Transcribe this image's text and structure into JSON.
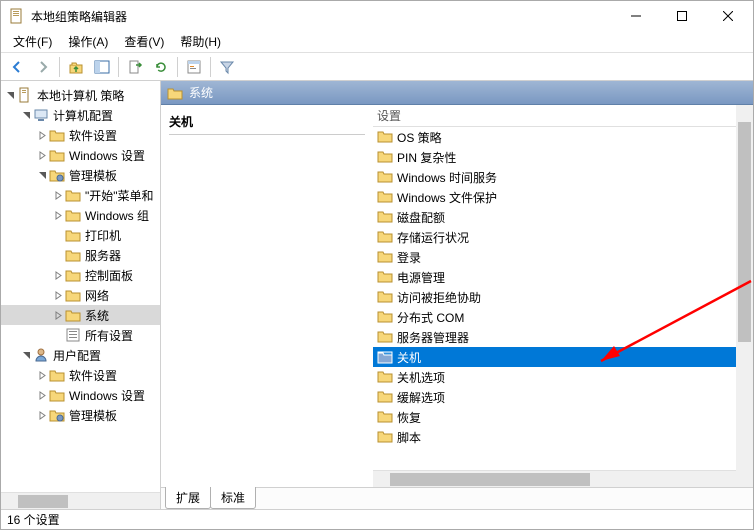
{
  "window": {
    "title": "本地组策略编辑器"
  },
  "menu": {
    "file": "文件(F)",
    "action": "操作(A)",
    "view": "查看(V)",
    "help": "帮助(H)"
  },
  "tree": {
    "root": "本地计算机 策略",
    "computer": "计算机配置",
    "soft": "软件设置",
    "winset": "Windows 设置",
    "admin": "管理模板",
    "start": "\"开始\"菜单和",
    "wincomp": "Windows 组",
    "printer": "打印机",
    "server": "服务器",
    "cpl": "控制面板",
    "network": "网络",
    "system": "系统",
    "allset": "所有设置",
    "user": "用户配置",
    "usoft": "软件设置",
    "uwinset": "Windows 设置",
    "uadmin": "管理模板"
  },
  "right": {
    "header": "系统",
    "section": "关机",
    "col": "设置",
    "items": [
      "OS 策略",
      "PIN 复杂性",
      "Windows 时间服务",
      "Windows 文件保护",
      "磁盘配额",
      "存储运行状况",
      "登录",
      "电源管理",
      "访问被拒绝协助",
      "分布式 COM",
      "服务器管理器",
      "关机",
      "关机选项",
      "缓解选项",
      "恢复",
      "脚本"
    ],
    "selected": 11
  },
  "tabs": {
    "ext": "扩展",
    "std": "标准"
  },
  "status": "16 个设置"
}
